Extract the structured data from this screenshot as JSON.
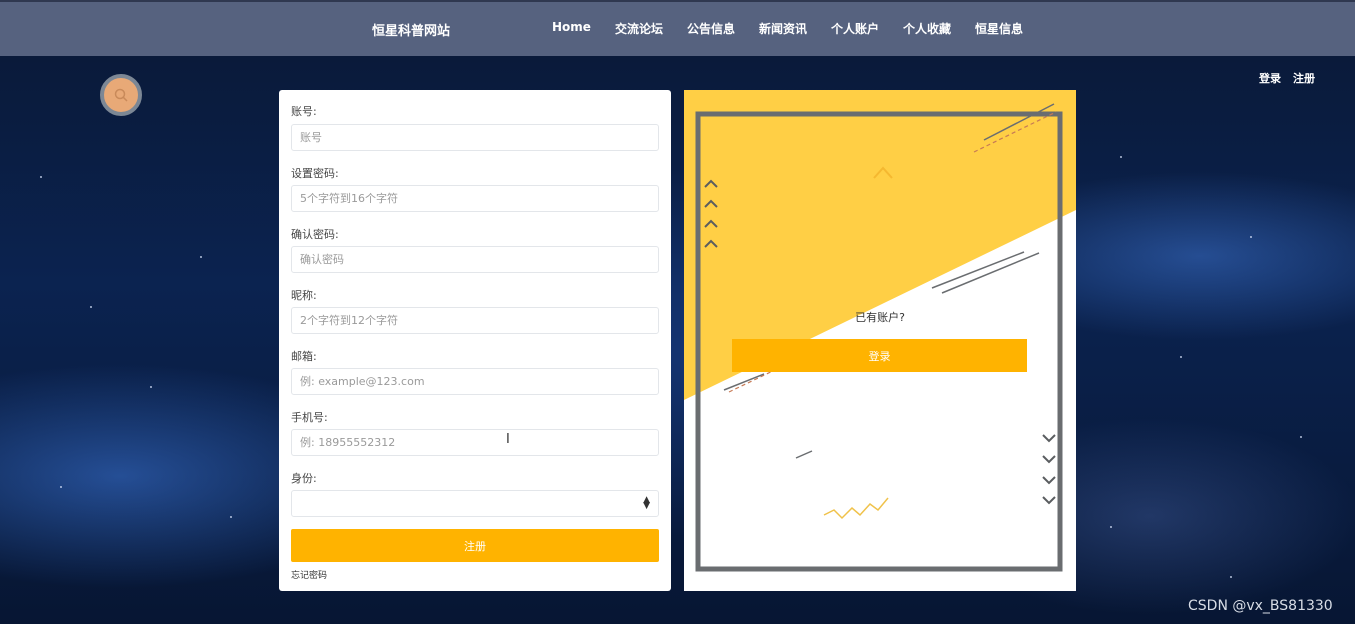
{
  "header": {
    "site_title": "恒星科普网站",
    "nav": [
      "Home",
      "交流论坛",
      "公告信息",
      "新闻资讯",
      "个人账户",
      "个人收藏",
      "恒星信息"
    ]
  },
  "auth": {
    "login": "登录",
    "register": "注册"
  },
  "form": {
    "fields": [
      {
        "label": "账号:",
        "placeholder": "账号"
      },
      {
        "label": "设置密码:",
        "placeholder": "5个字符到16个字符"
      },
      {
        "label": "确认密码:",
        "placeholder": "确认密码"
      },
      {
        "label": "昵称:",
        "placeholder": "2个字符到12个字符"
      },
      {
        "label": "邮箱:",
        "placeholder": "例: example@123.com"
      },
      {
        "label": "手机号:",
        "placeholder": "例: 18955552312"
      }
    ],
    "role_label": "身份:",
    "role_value": "",
    "submit_label": "注册",
    "forgot_label": "忘记密码"
  },
  "side_panel": {
    "question": "已有账户?",
    "login_label": "登录"
  },
  "watermark": "CSDN @vx_BS81330",
  "icons": {
    "search": "search-icon",
    "select_arrow": "select-arrows-icon"
  },
  "colors": {
    "accent": "#ffb300",
    "topbar": "#56627f",
    "panel_yellow": "#ffcf45",
    "frame": "#6a6d70"
  }
}
